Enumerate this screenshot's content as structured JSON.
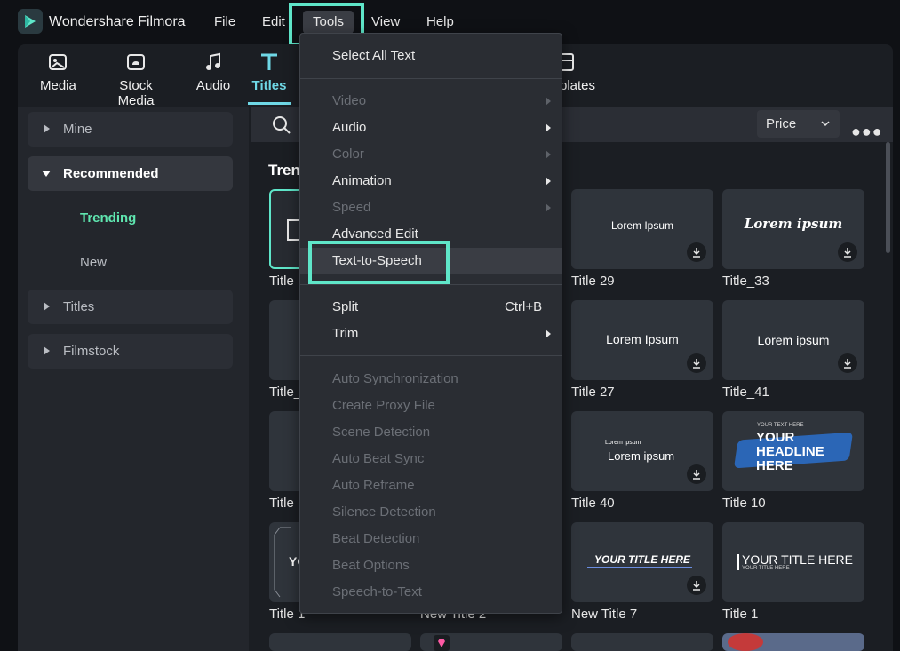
{
  "app": {
    "name": "Wondershare Filmora"
  },
  "menubar": {
    "file": "File",
    "edit": "Edit",
    "tools": "Tools",
    "view": "View",
    "help": "Help"
  },
  "toolbar": {
    "media": "Media",
    "stock_media": "Stock Media",
    "audio": "Audio",
    "titles": "Titles",
    "templates_partial": "plates"
  },
  "sidebar": {
    "mine": "Mine",
    "recommended": "Recommended",
    "trending": "Trending",
    "new": "New",
    "titles": "Titles",
    "filmstock": "Filmstock"
  },
  "content": {
    "price": "Price",
    "section_partial": "Tren",
    "cards": [
      {
        "label": "Title",
        "text": ""
      },
      {
        "label": "Title 29",
        "text": "Lorem Ipsum"
      },
      {
        "label": "Title_33",
        "text": "Lorem ipsum"
      },
      {
        "label": "Title_",
        "text": ""
      },
      {
        "label": "Title 27",
        "text": "Lorem Ipsum"
      },
      {
        "label": "Title_41",
        "text": "Lorem ipsum"
      },
      {
        "label": "Title",
        "text": ""
      },
      {
        "label": "Title 40",
        "text": "Lorem ipsum",
        "small": "Lorem ipsum"
      },
      {
        "label": "Title 10",
        "text": "YOUR HEADLINE HERE",
        "small": "YOUR TEXT HERE"
      },
      {
        "label": "Title 1",
        "text": "YO"
      },
      {
        "label": "New Title 2",
        "text": ""
      },
      {
        "label": "New Title 7",
        "text": "YOUR TITLE HERE"
      },
      {
        "label": "Title 1",
        "text": "YOUR TITLE HERE",
        "small": "YOUR TITLE HERE"
      }
    ]
  },
  "dropdown": {
    "select_all_text": "Select All Text",
    "video": "Video",
    "audio": "Audio",
    "color": "Color",
    "animation": "Animation",
    "speed": "Speed",
    "advanced_edit": "Advanced Edit",
    "text_to_speech": "Text-to-Speech",
    "split": "Split",
    "split_shortcut": "Ctrl+B",
    "trim": "Trim",
    "auto_sync": "Auto Synchronization",
    "create_proxy": "Create Proxy File",
    "scene_detection": "Scene Detection",
    "auto_beat_sync": "Auto Beat Sync",
    "auto_reframe": "Auto Reframe",
    "silence_detection": "Silence Detection",
    "beat_detection": "Beat Detection",
    "beat_options": "Beat Options",
    "speech_to_text": "Speech-to-Text"
  },
  "colors": {
    "accent": "#5fe6c9",
    "titles_tab": "#6fd8e6",
    "trending": "#5fe6b0"
  }
}
